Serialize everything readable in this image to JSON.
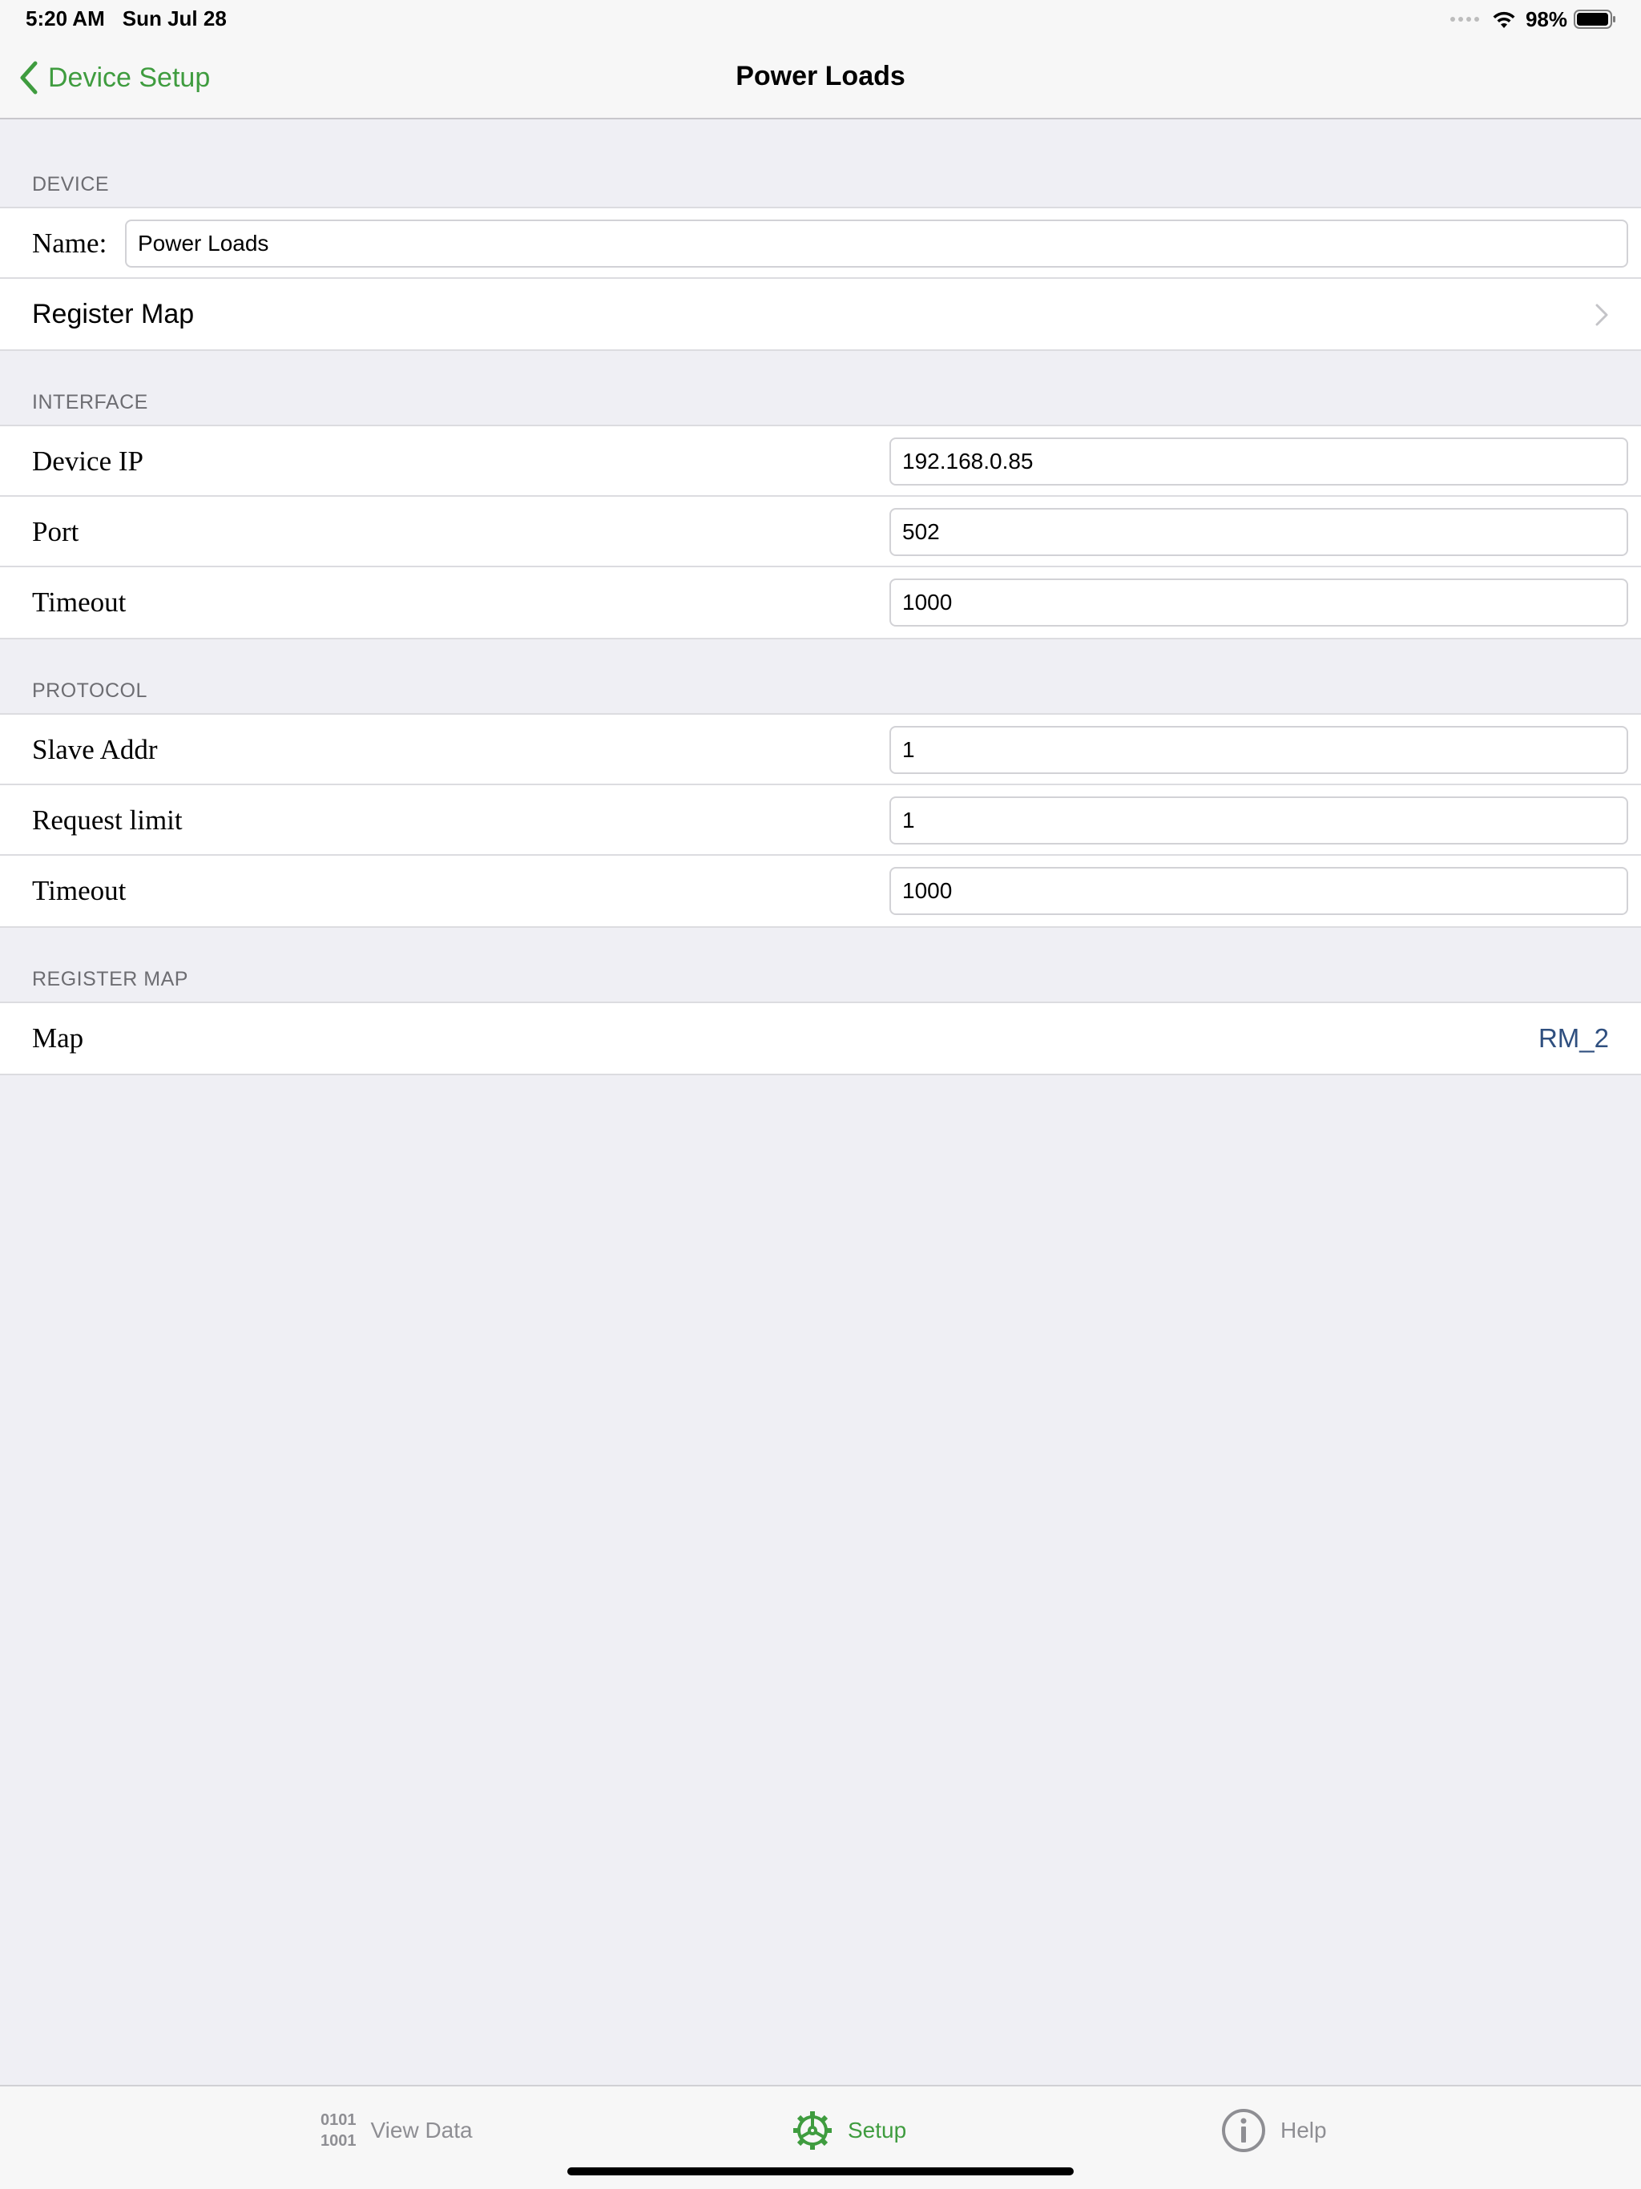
{
  "status_bar": {
    "time": "5:20 AM",
    "date": "Sun Jul 28",
    "battery": "98%"
  },
  "nav": {
    "back_label": "Device Setup",
    "title": "Power Loads",
    "accent_color": "#3f9c3f"
  },
  "device_section": {
    "header": "DEVICE",
    "name_label": "Name:",
    "name_value": "Power Loads",
    "register_map_label": "Register Map"
  },
  "interface_section": {
    "header": "INTERFACE",
    "rows": [
      {
        "label": "Device IP",
        "value": "192.168.0.85"
      },
      {
        "label": "Port",
        "value": "502"
      },
      {
        "label": "Timeout",
        "value": "1000"
      }
    ]
  },
  "protocol_section": {
    "header": "PROTOCOL",
    "rows": [
      {
        "label": "Slave Addr",
        "value": "1"
      },
      {
        "label": "Request limit",
        "value": "1"
      },
      {
        "label": "Timeout",
        "value": "1000"
      }
    ]
  },
  "register_map_section": {
    "header": "REGISTER MAP",
    "map_label": "Map",
    "map_value": "RM_2"
  },
  "tab_bar": {
    "tabs": [
      {
        "label": "View Data",
        "icon": "binary-icon",
        "icon_text_top": "0101",
        "icon_text_bottom": "1001"
      },
      {
        "label": "Setup",
        "icon": "gear-icon",
        "selected": true
      },
      {
        "label": "Help",
        "icon": "info-icon"
      }
    ]
  }
}
